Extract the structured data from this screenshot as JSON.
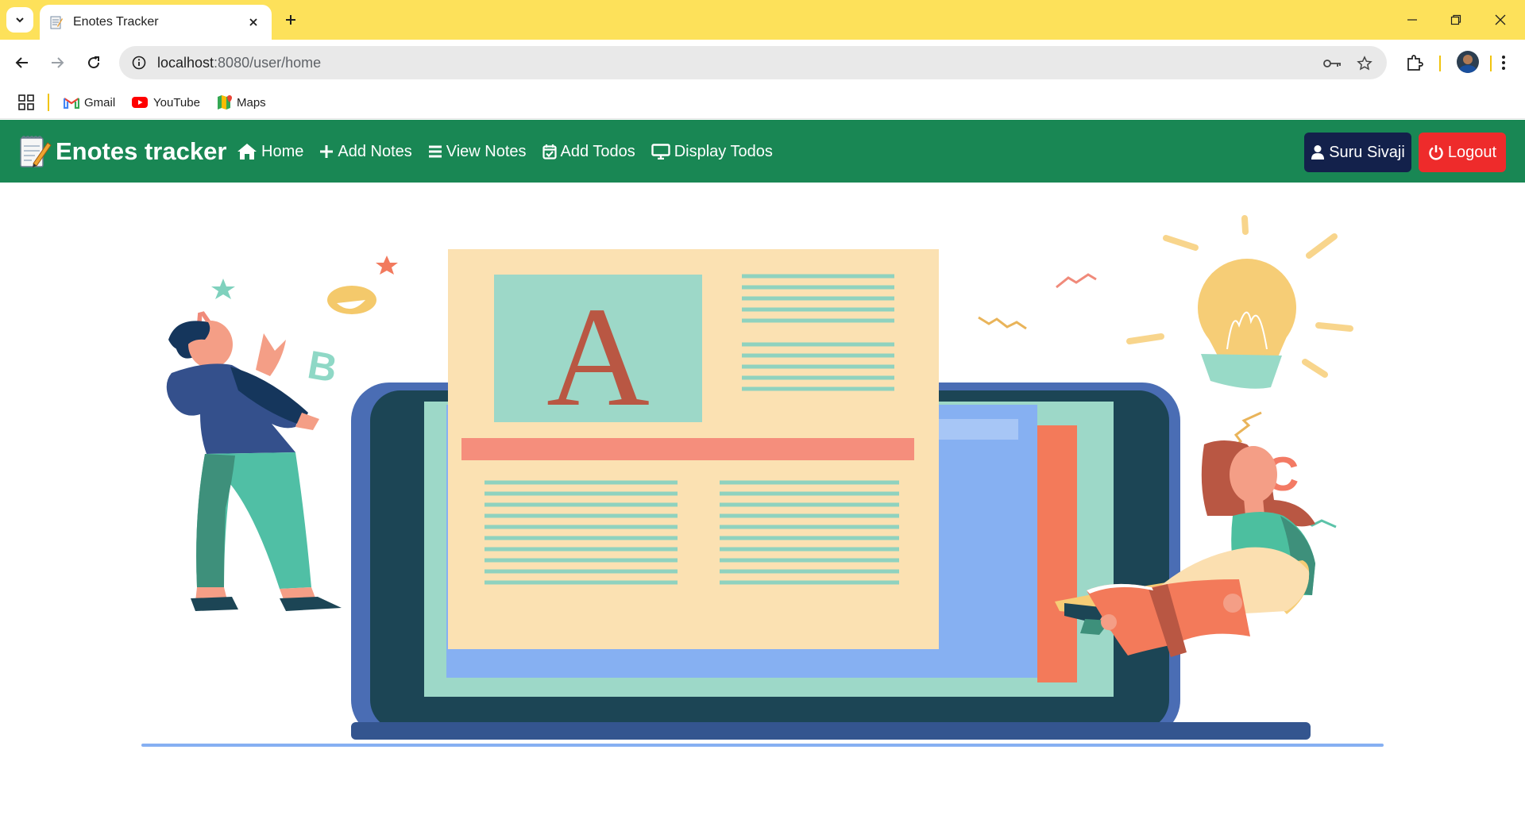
{
  "browser": {
    "tab_title": "Enotes Tracker",
    "url_host": "localhost",
    "url_rest": ":8080/user/home",
    "bookmarks": [
      {
        "label": "Gmail",
        "icon": "gmail-icon"
      },
      {
        "label": "YouTube",
        "icon": "youtube-icon"
      },
      {
        "label": "Maps",
        "icon": "maps-icon"
      }
    ]
  },
  "navbar": {
    "brand": "Enotes tracker",
    "links": [
      {
        "label": "Home",
        "icon": "home-icon"
      },
      {
        "label": "Add Notes",
        "icon": "plus-icon"
      },
      {
        "label": "View Notes",
        "icon": "list-icon"
      },
      {
        "label": "Add Todos",
        "icon": "calendar-check-icon"
      },
      {
        "label": "Display Todos",
        "icon": "monitor-icon"
      }
    ],
    "user_label": "Suru Sivaji",
    "logout_label": "Logout"
  },
  "colors": {
    "tabstrip": "#fde15a",
    "navbar": "#198754",
    "user_button": "#13214b",
    "logout_button": "#ee2b2b"
  },
  "hero": {
    "letters": [
      "A",
      "B",
      "C",
      "A"
    ]
  }
}
